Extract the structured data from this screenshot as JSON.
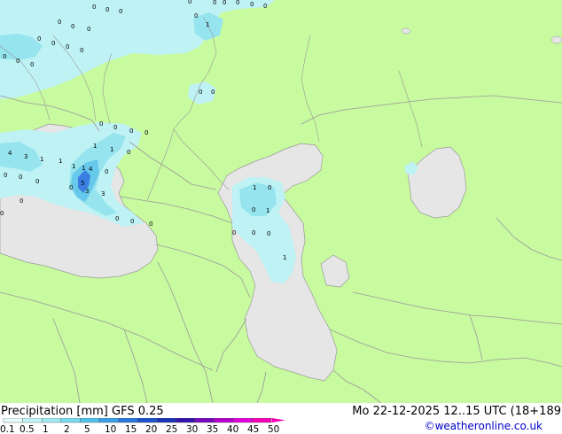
{
  "footer": {
    "title": "Precipitation [mm]  GFS 0.25",
    "datetime": "Mo 22-12-2025 12..15 UTC (18+189",
    "credit": "©weatheronline.co.uk"
  },
  "legend": {
    "ticks": [
      "0.1",
      "0.5",
      "1",
      "2",
      "5",
      "10",
      "15",
      "20",
      "25",
      "30",
      "35",
      "40",
      "45",
      "50"
    ],
    "colors": [
      "#e8fdfd",
      "#c0f4f6",
      "#a0ebf2",
      "#78dcee",
      "#4fc2ec",
      "#3a9fe6",
      "#2a78de",
      "#1d50cc",
      "#1a34b6",
      "#3214ac",
      "#7808c0",
      "#b400ce",
      "#e000dc",
      "#f500b8"
    ]
  },
  "colors": {
    "land": "#c8fa9f",
    "sea": "#e6e6e6",
    "border": "#9a9a9a",
    "precip_light": "#bff2f4",
    "precip_mid": "#96e4ee",
    "precip_strong": "#66c8ea",
    "precip_core": "#3b7ee2"
  },
  "precip_values": [
    {
      "t": "0"
    },
    {
      "t": "0"
    },
    {
      "t": "0"
    },
    {
      "t": "0"
    },
    {
      "t": "0"
    },
    {
      "t": "0"
    },
    {
      "t": "0"
    },
    {
      "t": "0"
    },
    {
      "t": "0"
    },
    {
      "t": "1"
    },
    {
      "t": "0"
    },
    {
      "t": "0"
    },
    {
      "t": "0"
    },
    {
      "t": "0"
    },
    {
      "t": "0"
    },
    {
      "t": "0"
    },
    {
      "t": "0"
    },
    {
      "t": "0"
    },
    {
      "t": "0"
    },
    {
      "t": "0"
    },
    {
      "t": "0"
    },
    {
      "t": "0"
    },
    {
      "t": "0"
    },
    {
      "t": "0"
    },
    {
      "t": "0"
    },
    {
      "t": "0"
    },
    {
      "t": "0"
    },
    {
      "t": "1"
    },
    {
      "t": "1"
    },
    {
      "t": "0"
    },
    {
      "t": "4"
    },
    {
      "t": "3"
    },
    {
      "t": "1"
    },
    {
      "t": "1"
    },
    {
      "t": "0"
    },
    {
      "t": "0"
    },
    {
      "t": "0"
    },
    {
      "t": "1"
    },
    {
      "t": "1"
    },
    {
      "t": "4"
    },
    {
      "t": "0"
    },
    {
      "t": "0"
    },
    {
      "t": "0"
    },
    {
      "t": "5"
    },
    {
      "t": "3"
    },
    {
      "t": "3"
    },
    {
      "t": "0"
    },
    {
      "t": "0"
    },
    {
      "t": "0"
    },
    {
      "t": "1"
    },
    {
      "t": "0"
    },
    {
      "t": "0"
    },
    {
      "t": "1"
    },
    {
      "t": "0"
    },
    {
      "t": "0"
    },
    {
      "t": "0"
    },
    {
      "t": "1"
    },
    {
      "t": "0"
    }
  ]
}
